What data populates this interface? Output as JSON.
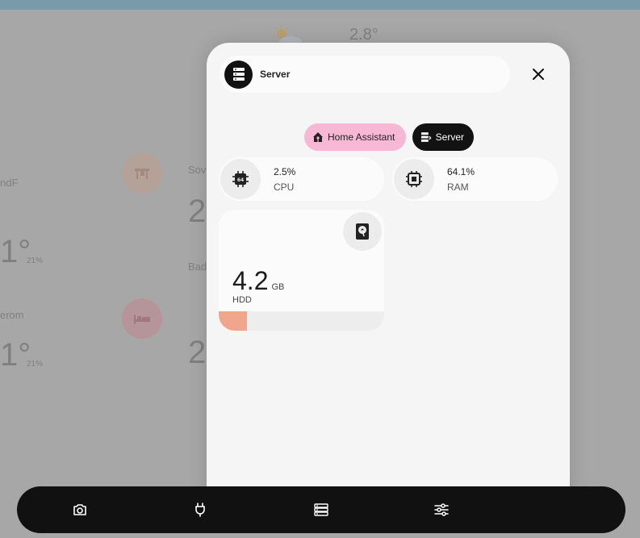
{
  "background": {
    "weather_temp": "2.8°",
    "rooms": [
      {
        "label": "ndF",
        "temp": "1°",
        "humidity": "21%"
      },
      {
        "label": "erom",
        "temp": "1°",
        "humidity": "21%"
      },
      {
        "label": "Sov",
        "temp": "2"
      },
      {
        "label": "Bad",
        "temp": "2"
      }
    ]
  },
  "modal": {
    "title": "Server",
    "header_icon": "server-icon",
    "chips": [
      {
        "label": "Home Assistant",
        "icon": "home-assistant-icon",
        "active": false
      },
      {
        "label": "Server",
        "icon": "server-rack-icon",
        "active": true
      }
    ],
    "stats": [
      {
        "value": "2.5%",
        "label": "CPU",
        "icon": "cpu-64bit-icon"
      },
      {
        "value": "64.1%",
        "label": "RAM",
        "icon": "memory-chip-icon"
      }
    ],
    "hdd": {
      "value": "4.2",
      "unit": "GB",
      "label": "HDD",
      "icon": "harddisk-icon",
      "fill_fraction": 0.17,
      "fill_color": "#f0a58d"
    }
  },
  "bottom_nav": [
    {
      "icon": "camera-icon"
    },
    {
      "icon": "power-plug-icon"
    },
    {
      "icon": "server-icon"
    },
    {
      "icon": "tune-icon"
    }
  ],
  "colors": {
    "accent_pink": "#f6b8d4",
    "dark": "#111111",
    "hdd_fill": "#f0a58d"
  }
}
